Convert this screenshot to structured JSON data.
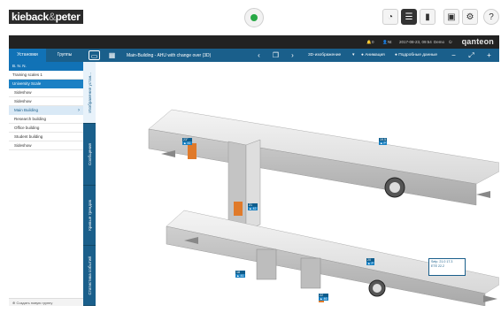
{
  "header": {
    "logo_text": "kieback",
    "logo_amp": "&",
    "logo_text2": "peter",
    "status": "ok",
    "icons": [
      "gauge-icon",
      "list-icon",
      "chart-icon",
      "screen-icon",
      "gear-icon",
      "help-icon"
    ],
    "help_label": "?"
  },
  "infobar": {
    "alarm_count": "0",
    "user": "Nt",
    "datetime": "2017-08-23, 09:54",
    "extra": "Demo",
    "brand": "qanteon"
  },
  "toolbar": {
    "tabs": [
      "Установки",
      "Группы"
    ],
    "title": "Main-Building - AHU with change over (3D)",
    "view_mode": "3D-изображение",
    "animation": "Анимация",
    "details": "Подробные данные"
  },
  "sidebar": {
    "items": [
      {
        "label": "B. N. N.",
        "style": "blue"
      },
      {
        "label": "Training scales 1",
        "style": "white"
      },
      {
        "label": "University Scale",
        "style": "blue2"
      },
      {
        "label": "Sideshow",
        "style": "white"
      },
      {
        "label": "Sideshow",
        "style": "white"
      },
      {
        "label": "Main Building",
        "style": "sel"
      },
      {
        "label": "Research building",
        "style": "white"
      },
      {
        "label": "Office building",
        "style": "white"
      },
      {
        "label": "Student building",
        "style": "white"
      },
      {
        "label": "Sideshow",
        "style": "white"
      }
    ],
    "bottom_link": "Создать новую группу"
  },
  "side_tabs": [
    {
      "label": "Изображения устан..."
    },
    {
      "label": "Сообщения"
    },
    {
      "label": "Кривые трендов"
    },
    {
      "label": "Статистика событий"
    }
  ],
  "viewport": {
    "tags": [
      {
        "head": "23°",
        "body": "▲ 41"
      },
      {
        "head": "19.5",
        "body": "▲ P"
      },
      {
        "head": "21",
        "body": "▲ 42"
      },
      {
        "head": "20",
        "body": "▲ P"
      },
      {
        "head": "18",
        "body": "▲ 41"
      },
      {
        "head": "22",
        "body": "▲ 46"
      }
    ],
    "legend_line1": "Setp. 21.0  17.3",
    "legend_line2": "ЕТЕ 22.2"
  }
}
